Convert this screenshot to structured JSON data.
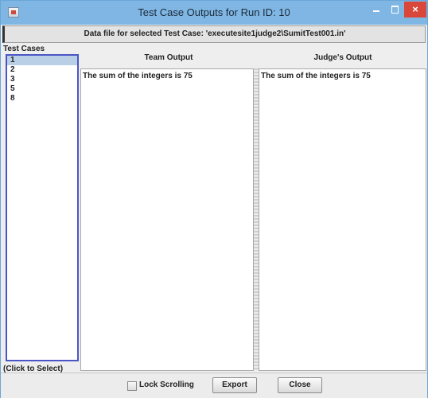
{
  "window": {
    "title": "Test Case Outputs for Run ID:  10"
  },
  "info": {
    "text": "Data file for selected Test Case: 'executesite1judge2\\SumitTest001.in'"
  },
  "test_cases": {
    "label": "Test Cases",
    "items": [
      "1",
      "2",
      "3",
      "5",
      "8"
    ],
    "selected": "1",
    "hint": "(Click to Select)"
  },
  "team_output": {
    "header": "Team Output",
    "content": "The sum of the integers is 75"
  },
  "judge_output": {
    "header": "Judge's Output",
    "content": "The sum of the integers is 75"
  },
  "controls": {
    "lock_scrolling_label": "Lock Scrolling",
    "lock_scrolling_checked": false,
    "export_label": "Export",
    "close_label": "Close"
  },
  "icons": {
    "close": "×"
  },
  "colors": {
    "titlebar": "#7fb6e3",
    "close_button": "#d9473a",
    "list_border": "#4b56c6",
    "selection": "#b8cfe5"
  }
}
